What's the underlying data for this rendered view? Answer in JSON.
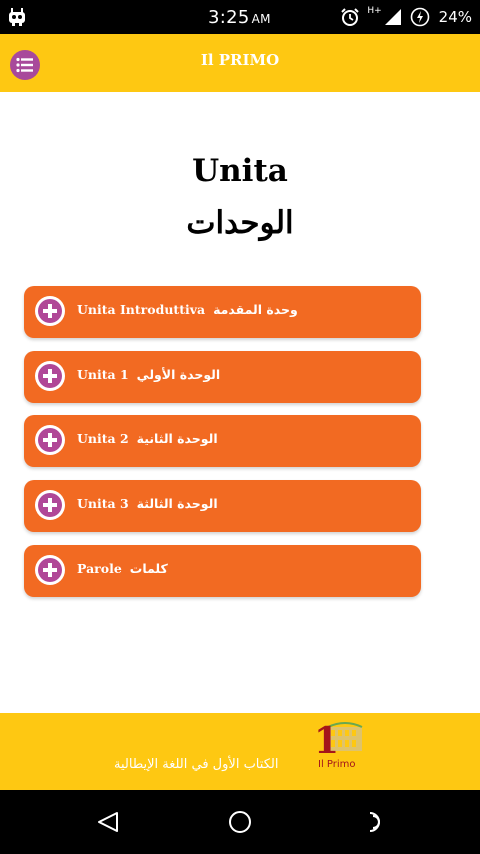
{
  "status_bar": {
    "time": "3:25",
    "ampm": "AM",
    "network": "H+",
    "battery": "24%",
    "icons": [
      "android-debug-icon",
      "alarm-icon",
      "signal-icon",
      "battery-icon"
    ]
  },
  "app_bar": {
    "title": "Il PRIMO",
    "menu_icon": "list-icon",
    "accent_color": "#fec812",
    "menu_color": "#a8499b"
  },
  "headings": {
    "italian": "Unita",
    "arabic": "الوحدات"
  },
  "units": [
    {
      "italian": "Unita Introduttiva",
      "arabic": "وحدة المقدمة"
    },
    {
      "italian": "Unita 1",
      "arabic": "الوحدة الأولي"
    },
    {
      "italian": "Unita 2",
      "arabic": "الوحدة الثانية"
    },
    {
      "italian": "Unita 3",
      "arabic": "الوحدة الثالثة"
    },
    {
      "italian": "Parole",
      "arabic": "كلمات"
    }
  ],
  "unit_button_color": "#f26a22",
  "plus_icon_color": "#b04797",
  "footer": {
    "logo_text": "Il Primo",
    "logo_numeral": "1",
    "tagline": "الكتاب الأول في اللغة الإيطالية"
  },
  "nav_bar": {
    "icons": [
      "back-icon",
      "home-icon",
      "recent-apps-icon"
    ]
  }
}
